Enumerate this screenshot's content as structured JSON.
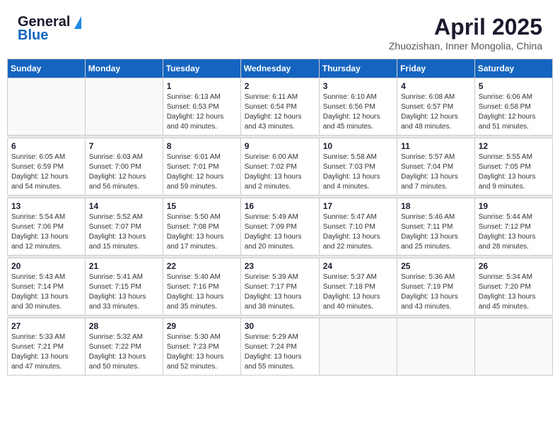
{
  "header": {
    "logo_general": "General",
    "logo_blue": "Blue",
    "month": "April 2025",
    "location": "Zhuozishan, Inner Mongolia, China"
  },
  "weekdays": [
    "Sunday",
    "Monday",
    "Tuesday",
    "Wednesday",
    "Thursday",
    "Friday",
    "Saturday"
  ],
  "weeks": [
    [
      {
        "day": "",
        "content": ""
      },
      {
        "day": "",
        "content": ""
      },
      {
        "day": "1",
        "content": "Sunrise: 6:13 AM\nSunset: 6:53 PM\nDaylight: 12 hours\nand 40 minutes."
      },
      {
        "day": "2",
        "content": "Sunrise: 6:11 AM\nSunset: 6:54 PM\nDaylight: 12 hours\nand 43 minutes."
      },
      {
        "day": "3",
        "content": "Sunrise: 6:10 AM\nSunset: 6:56 PM\nDaylight: 12 hours\nand 45 minutes."
      },
      {
        "day": "4",
        "content": "Sunrise: 6:08 AM\nSunset: 6:57 PM\nDaylight: 12 hours\nand 48 minutes."
      },
      {
        "day": "5",
        "content": "Sunrise: 6:06 AM\nSunset: 6:58 PM\nDaylight: 12 hours\nand 51 minutes."
      }
    ],
    [
      {
        "day": "6",
        "content": "Sunrise: 6:05 AM\nSunset: 6:59 PM\nDaylight: 12 hours\nand 54 minutes."
      },
      {
        "day": "7",
        "content": "Sunrise: 6:03 AM\nSunset: 7:00 PM\nDaylight: 12 hours\nand 56 minutes."
      },
      {
        "day": "8",
        "content": "Sunrise: 6:01 AM\nSunset: 7:01 PM\nDaylight: 12 hours\nand 59 minutes."
      },
      {
        "day": "9",
        "content": "Sunrise: 6:00 AM\nSunset: 7:02 PM\nDaylight: 13 hours\nand 2 minutes."
      },
      {
        "day": "10",
        "content": "Sunrise: 5:58 AM\nSunset: 7:03 PM\nDaylight: 13 hours\nand 4 minutes."
      },
      {
        "day": "11",
        "content": "Sunrise: 5:57 AM\nSunset: 7:04 PM\nDaylight: 13 hours\nand 7 minutes."
      },
      {
        "day": "12",
        "content": "Sunrise: 5:55 AM\nSunset: 7:05 PM\nDaylight: 13 hours\nand 9 minutes."
      }
    ],
    [
      {
        "day": "13",
        "content": "Sunrise: 5:54 AM\nSunset: 7:06 PM\nDaylight: 13 hours\nand 12 minutes."
      },
      {
        "day": "14",
        "content": "Sunrise: 5:52 AM\nSunset: 7:07 PM\nDaylight: 13 hours\nand 15 minutes."
      },
      {
        "day": "15",
        "content": "Sunrise: 5:50 AM\nSunset: 7:08 PM\nDaylight: 13 hours\nand 17 minutes."
      },
      {
        "day": "16",
        "content": "Sunrise: 5:49 AM\nSunset: 7:09 PM\nDaylight: 13 hours\nand 20 minutes."
      },
      {
        "day": "17",
        "content": "Sunrise: 5:47 AM\nSunset: 7:10 PM\nDaylight: 13 hours\nand 22 minutes."
      },
      {
        "day": "18",
        "content": "Sunrise: 5:46 AM\nSunset: 7:11 PM\nDaylight: 13 hours\nand 25 minutes."
      },
      {
        "day": "19",
        "content": "Sunrise: 5:44 AM\nSunset: 7:12 PM\nDaylight: 13 hours\nand 28 minutes."
      }
    ],
    [
      {
        "day": "20",
        "content": "Sunrise: 5:43 AM\nSunset: 7:14 PM\nDaylight: 13 hours\nand 30 minutes."
      },
      {
        "day": "21",
        "content": "Sunrise: 5:41 AM\nSunset: 7:15 PM\nDaylight: 13 hours\nand 33 minutes."
      },
      {
        "day": "22",
        "content": "Sunrise: 5:40 AM\nSunset: 7:16 PM\nDaylight: 13 hours\nand 35 minutes."
      },
      {
        "day": "23",
        "content": "Sunrise: 5:39 AM\nSunset: 7:17 PM\nDaylight: 13 hours\nand 38 minutes."
      },
      {
        "day": "24",
        "content": "Sunrise: 5:37 AM\nSunset: 7:18 PM\nDaylight: 13 hours\nand 40 minutes."
      },
      {
        "day": "25",
        "content": "Sunrise: 5:36 AM\nSunset: 7:19 PM\nDaylight: 13 hours\nand 43 minutes."
      },
      {
        "day": "26",
        "content": "Sunrise: 5:34 AM\nSunset: 7:20 PM\nDaylight: 13 hours\nand 45 minutes."
      }
    ],
    [
      {
        "day": "27",
        "content": "Sunrise: 5:33 AM\nSunset: 7:21 PM\nDaylight: 13 hours\nand 47 minutes."
      },
      {
        "day": "28",
        "content": "Sunrise: 5:32 AM\nSunset: 7:22 PM\nDaylight: 13 hours\nand 50 minutes."
      },
      {
        "day": "29",
        "content": "Sunrise: 5:30 AM\nSunset: 7:23 PM\nDaylight: 13 hours\nand 52 minutes."
      },
      {
        "day": "30",
        "content": "Sunrise: 5:29 AM\nSunset: 7:24 PM\nDaylight: 13 hours\nand 55 minutes."
      },
      {
        "day": "",
        "content": ""
      },
      {
        "day": "",
        "content": ""
      },
      {
        "day": "",
        "content": ""
      }
    ]
  ]
}
